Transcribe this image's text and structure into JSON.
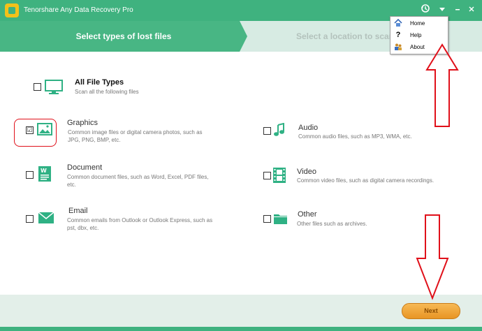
{
  "app": {
    "title": "Tenorshare Any Data Recovery Pro"
  },
  "steps": {
    "current": "Select types of lost files",
    "next": "Select a location to scan"
  },
  "file_types": {
    "all": {
      "title": "All File Types",
      "desc": "Scan all the following files",
      "checked": false
    },
    "graphics": {
      "title": "Graphics",
      "desc_line1": "Common image files or digital camera photos, such as",
      "desc_line2": "JPG, PNG, BMP, etc.",
      "checked": true
    },
    "document": {
      "title": "Document",
      "desc_line1": "Common document files, such as Word, Excel, PDF files,",
      "desc_line2": "etc.",
      "checked": false
    },
    "email": {
      "title": "Email",
      "desc_line1": "Common emails from Outlook or Outlook Express, such as",
      "desc_line2": "pst, dbx, etc.",
      "checked": false
    },
    "audio": {
      "title": "Audio",
      "desc": "Common audio files, such as MP3, WMA, etc.",
      "checked": false
    },
    "video": {
      "title": "Video",
      "desc": "Common video files, such as digital camera recordings.",
      "checked": false
    },
    "other": {
      "title": "Other",
      "desc": "Other files such as archives.",
      "checked": false
    }
  },
  "menu": {
    "items": [
      "Home",
      "Help",
      "About"
    ]
  },
  "footer": {
    "next_label": "Next"
  },
  "checkmark": "☑",
  "icons": {
    "history": "history-icon",
    "menu": "dropdown-icon",
    "minimize": "minimize-icon",
    "close": "close-icon"
  },
  "colors": {
    "brand": "#3fb27f",
    "accent": "#f0a53a",
    "annotation": "#e0101a"
  }
}
